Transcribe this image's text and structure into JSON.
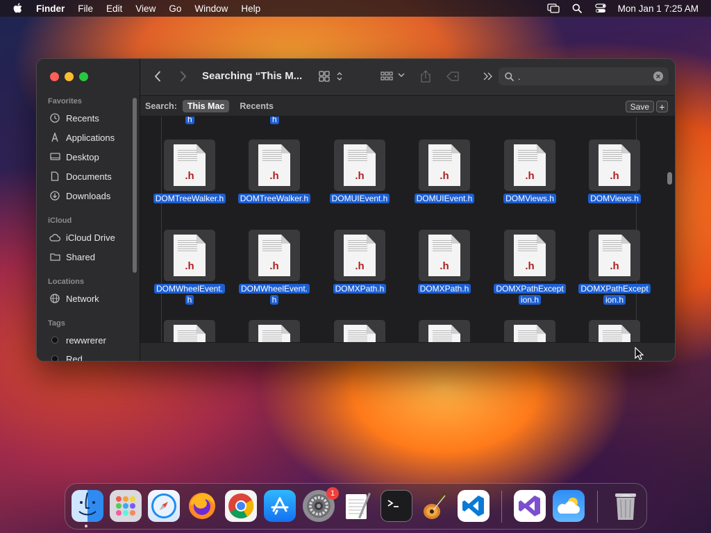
{
  "menubar": {
    "app_name": "Finder",
    "items": [
      "File",
      "Edit",
      "View",
      "Go",
      "Window",
      "Help"
    ],
    "clock": "Mon Jan 1  7:25 AM"
  },
  "window": {
    "title": "Searching “This M...",
    "search_value": ".",
    "scope_label": "Search:",
    "scope_this_mac": "This Mac",
    "scope_recents": "Recents",
    "save_label": "Save",
    "add_label": "+"
  },
  "sidebar": {
    "favorites_label": "Favorites",
    "favorites": [
      "Recents",
      "Applications",
      "Desktop",
      "Documents",
      "Downloads"
    ],
    "icloud_label": "iCloud",
    "icloud": [
      "iCloud Drive",
      "Shared"
    ],
    "locations_label": "Locations",
    "locations": [
      "Network"
    ],
    "tags_label": "Tags",
    "tags": [
      {
        "name": "rewwrerer",
        "color": "#1a1a1a"
      },
      {
        "name": "Red",
        "color": "#1a1a1a"
      }
    ]
  },
  "files": {
    "ext_label": ".h",
    "top_partial": [
      "h",
      "h"
    ],
    "row1": [
      "DOMTreeWalker.h",
      "DOMTreeWalker.h",
      "DOMUIEvent.h",
      "DOMUIEvent.h",
      "DOMViews.h",
      "DOMViews.h"
    ],
    "row2": [
      [
        "DOMWheelEvent.",
        "h"
      ],
      [
        "DOMWheelEvent.",
        "h"
      ],
      [
        "DOMXPath.h"
      ],
      [
        "DOMXPath.h"
      ],
      [
        "DOMXPathExcept",
        "ion.h"
      ],
      [
        "DOMXPathExcept",
        "ion.h"
      ]
    ]
  },
  "dock": {
    "settings_badge": "1",
    "apps": [
      "finder-icon",
      "launchpad-icon",
      "safari-icon",
      "firefox-icon",
      "chrome-icon",
      "app-store-icon",
      "system-settings-icon",
      "textedit-icon",
      "terminal-icon",
      "garageband-icon",
      "vscode-icon",
      "visual-studio-icon",
      "weather-icon",
      "trash-icon"
    ]
  },
  "colors": {
    "selection": "#1d5fd3",
    "close": "#ff5f57",
    "minimize": "#febc2e",
    "maximize": "#28c840"
  }
}
